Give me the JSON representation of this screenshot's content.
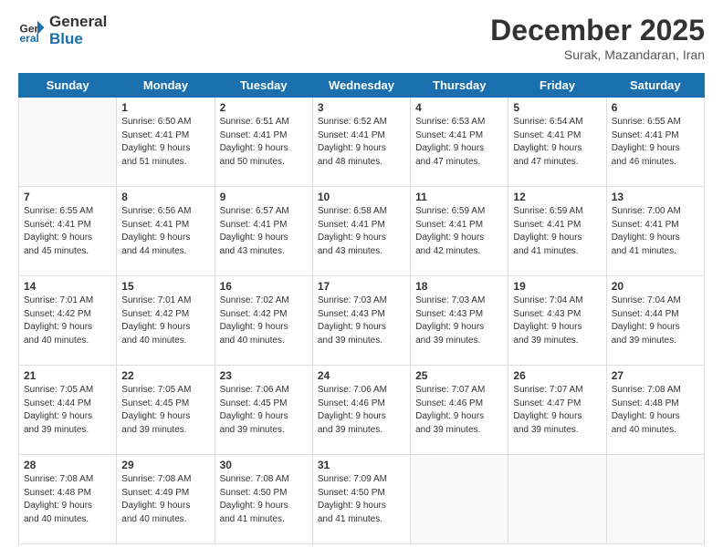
{
  "header": {
    "logo_line1": "General",
    "logo_line2": "Blue",
    "month": "December 2025",
    "location": "Surak, Mazandaran, Iran"
  },
  "weekdays": [
    "Sunday",
    "Monday",
    "Tuesday",
    "Wednesday",
    "Thursday",
    "Friday",
    "Saturday"
  ],
  "weeks": [
    [
      {
        "day": "",
        "info": ""
      },
      {
        "day": "1",
        "info": "Sunrise: 6:50 AM\nSunset: 4:41 PM\nDaylight: 9 hours\nand 51 minutes."
      },
      {
        "day": "2",
        "info": "Sunrise: 6:51 AM\nSunset: 4:41 PM\nDaylight: 9 hours\nand 50 minutes."
      },
      {
        "day": "3",
        "info": "Sunrise: 6:52 AM\nSunset: 4:41 PM\nDaylight: 9 hours\nand 48 minutes."
      },
      {
        "day": "4",
        "info": "Sunrise: 6:53 AM\nSunset: 4:41 PM\nDaylight: 9 hours\nand 47 minutes."
      },
      {
        "day": "5",
        "info": "Sunrise: 6:54 AM\nSunset: 4:41 PM\nDaylight: 9 hours\nand 47 minutes."
      },
      {
        "day": "6",
        "info": "Sunrise: 6:55 AM\nSunset: 4:41 PM\nDaylight: 9 hours\nand 46 minutes."
      }
    ],
    [
      {
        "day": "7",
        "info": "Sunrise: 6:55 AM\nSunset: 4:41 PM\nDaylight: 9 hours\nand 45 minutes."
      },
      {
        "day": "8",
        "info": "Sunrise: 6:56 AM\nSunset: 4:41 PM\nDaylight: 9 hours\nand 44 minutes."
      },
      {
        "day": "9",
        "info": "Sunrise: 6:57 AM\nSunset: 4:41 PM\nDaylight: 9 hours\nand 43 minutes."
      },
      {
        "day": "10",
        "info": "Sunrise: 6:58 AM\nSunset: 4:41 PM\nDaylight: 9 hours\nand 43 minutes."
      },
      {
        "day": "11",
        "info": "Sunrise: 6:59 AM\nSunset: 4:41 PM\nDaylight: 9 hours\nand 42 minutes."
      },
      {
        "day": "12",
        "info": "Sunrise: 6:59 AM\nSunset: 4:41 PM\nDaylight: 9 hours\nand 41 minutes."
      },
      {
        "day": "13",
        "info": "Sunrise: 7:00 AM\nSunset: 4:41 PM\nDaylight: 9 hours\nand 41 minutes."
      }
    ],
    [
      {
        "day": "14",
        "info": "Sunrise: 7:01 AM\nSunset: 4:42 PM\nDaylight: 9 hours\nand 40 minutes."
      },
      {
        "day": "15",
        "info": "Sunrise: 7:01 AM\nSunset: 4:42 PM\nDaylight: 9 hours\nand 40 minutes."
      },
      {
        "day": "16",
        "info": "Sunrise: 7:02 AM\nSunset: 4:42 PM\nDaylight: 9 hours\nand 40 minutes."
      },
      {
        "day": "17",
        "info": "Sunrise: 7:03 AM\nSunset: 4:43 PM\nDaylight: 9 hours\nand 39 minutes."
      },
      {
        "day": "18",
        "info": "Sunrise: 7:03 AM\nSunset: 4:43 PM\nDaylight: 9 hours\nand 39 minutes."
      },
      {
        "day": "19",
        "info": "Sunrise: 7:04 AM\nSunset: 4:43 PM\nDaylight: 9 hours\nand 39 minutes."
      },
      {
        "day": "20",
        "info": "Sunrise: 7:04 AM\nSunset: 4:44 PM\nDaylight: 9 hours\nand 39 minutes."
      }
    ],
    [
      {
        "day": "21",
        "info": "Sunrise: 7:05 AM\nSunset: 4:44 PM\nDaylight: 9 hours\nand 39 minutes."
      },
      {
        "day": "22",
        "info": "Sunrise: 7:05 AM\nSunset: 4:45 PM\nDaylight: 9 hours\nand 39 minutes."
      },
      {
        "day": "23",
        "info": "Sunrise: 7:06 AM\nSunset: 4:45 PM\nDaylight: 9 hours\nand 39 minutes."
      },
      {
        "day": "24",
        "info": "Sunrise: 7:06 AM\nSunset: 4:46 PM\nDaylight: 9 hours\nand 39 minutes."
      },
      {
        "day": "25",
        "info": "Sunrise: 7:07 AM\nSunset: 4:46 PM\nDaylight: 9 hours\nand 39 minutes."
      },
      {
        "day": "26",
        "info": "Sunrise: 7:07 AM\nSunset: 4:47 PM\nDaylight: 9 hours\nand 39 minutes."
      },
      {
        "day": "27",
        "info": "Sunrise: 7:08 AM\nSunset: 4:48 PM\nDaylight: 9 hours\nand 40 minutes."
      }
    ],
    [
      {
        "day": "28",
        "info": "Sunrise: 7:08 AM\nSunset: 4:48 PM\nDaylight: 9 hours\nand 40 minutes."
      },
      {
        "day": "29",
        "info": "Sunrise: 7:08 AM\nSunset: 4:49 PM\nDaylight: 9 hours\nand 40 minutes."
      },
      {
        "day": "30",
        "info": "Sunrise: 7:08 AM\nSunset: 4:50 PM\nDaylight: 9 hours\nand 41 minutes."
      },
      {
        "day": "31",
        "info": "Sunrise: 7:09 AM\nSunset: 4:50 PM\nDaylight: 9 hours\nand 41 minutes."
      },
      {
        "day": "",
        "info": ""
      },
      {
        "day": "",
        "info": ""
      },
      {
        "day": "",
        "info": ""
      }
    ]
  ]
}
